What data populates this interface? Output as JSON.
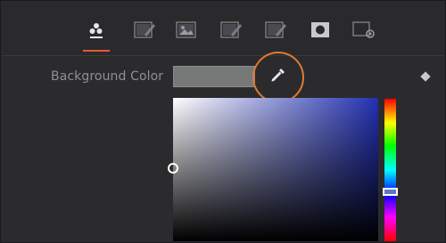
{
  "toolbar": {
    "tabs": [
      {
        "icon": "color-nodes-icon",
        "active": true
      },
      {
        "icon": "edit-sparkle-icon"
      },
      {
        "icon": "image-icon"
      },
      {
        "icon": "edit-sparkle-icon"
      },
      {
        "icon": "edit-sparkle-icon"
      },
      {
        "icon": "mask-icon"
      },
      {
        "icon": "settings-icon"
      }
    ],
    "accent": "#e55a36"
  },
  "background_color": {
    "label": "Background Color",
    "swatch_color": "#777978",
    "picker_icon": "eyedropper-icon",
    "keyframe_icon": "keyframe-diamond-icon",
    "highlight_color": "#e07a32"
  },
  "color_picker": {
    "hue_color": "#2230b0"
  }
}
